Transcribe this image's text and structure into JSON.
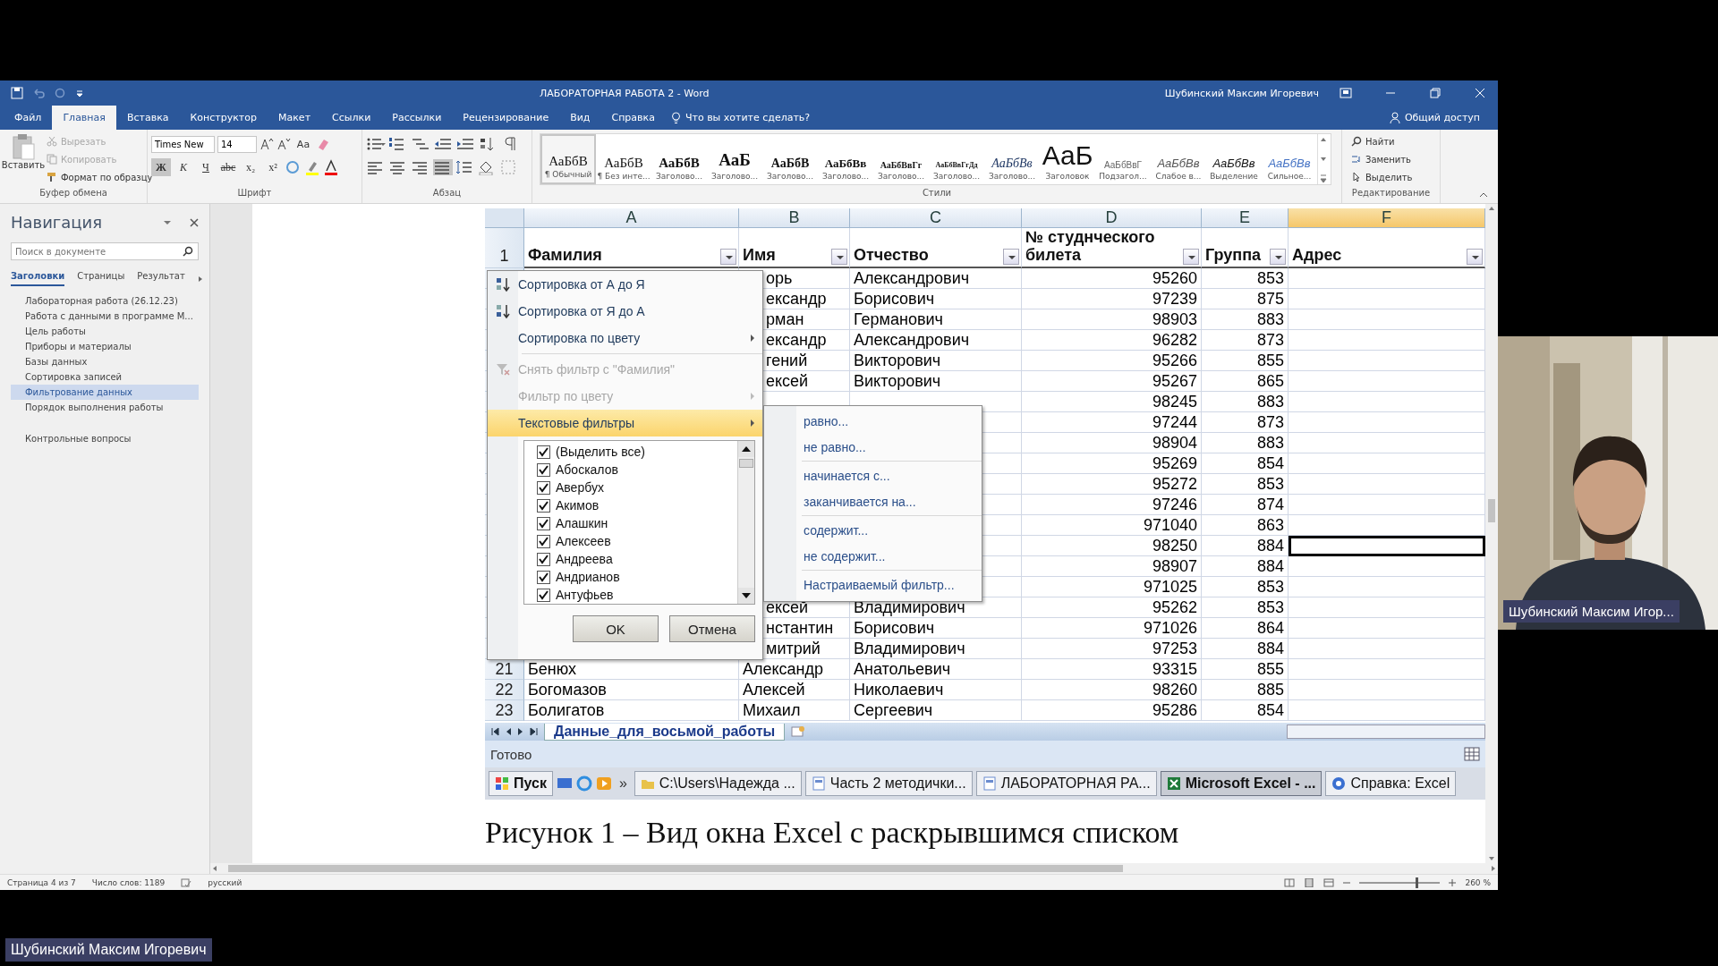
{
  "meeting": {
    "presenter_label": "Шубинский Максим Игоревич",
    "camera": {
      "kind": "picture",
      "name_label": "Шубинский Максим Игор..."
    }
  },
  "window": {
    "title": "ЛАБОРАТОРНАЯ РАБОТА 2  -  Word",
    "user": "Шубинский Максим Игоревич"
  },
  "tabs": [
    {
      "label": "Файл",
      "selected": false
    },
    {
      "label": "Главная",
      "selected": true
    },
    {
      "label": "Вставка",
      "selected": false
    },
    {
      "label": "Конструктор",
      "selected": false
    },
    {
      "label": "Макет",
      "selected": false
    },
    {
      "label": "Ссылки",
      "selected": false
    },
    {
      "label": "Рассылки",
      "selected": false
    },
    {
      "label": "Рецензирование",
      "selected": false
    },
    {
      "label": "Вид",
      "selected": false
    },
    {
      "label": "Справка",
      "selected": false
    }
  ],
  "tell_me": "Что вы хотите сделать?",
  "share": "Общий доступ",
  "ribbon": {
    "clipboard": {
      "label": "Буфер обмена",
      "paste": "Вставить",
      "items": [
        {
          "label": "Вырезать",
          "kind": "cut",
          "disabled": true
        },
        {
          "label": "Копировать",
          "kind": "copy",
          "disabled": true
        },
        {
          "label": "Формат по образцу",
          "kind": "painter",
          "disabled": false
        }
      ]
    },
    "font": {
      "label": "Шрифт",
      "family": "Times New",
      "size": "14",
      "case_button": "Aa",
      "format_buttons": [
        {
          "label": "Ж",
          "kind": "bold",
          "selected": true
        },
        {
          "label": "К",
          "kind": "italic",
          "selected": false
        },
        {
          "label": "Ч",
          "kind": "underline",
          "selected": false
        },
        {
          "label": "abc",
          "kind": "strike",
          "selected": false
        },
        {
          "label": "x₂",
          "kind": "sub",
          "selected": false
        },
        {
          "label": "x²",
          "kind": "sup",
          "selected": false
        }
      ]
    },
    "paragraph": {
      "label": "Абзац"
    },
    "styles": {
      "label": "Стили",
      "items": [
        {
          "preview": "АаБбВ",
          "name": "¶ Обычный",
          "kind": "normal",
          "selected": true
        },
        {
          "preview": "АаБбВ",
          "name": "¶ Без инте...",
          "kind": "normal",
          "selected": false
        },
        {
          "preview": "АаБбВ",
          "name": "Заголово...",
          "kind": "h1",
          "selected": false
        },
        {
          "preview": "АаБ",
          "name": "Заголово...",
          "kind": "h2",
          "selected": false
        },
        {
          "preview": "АаБбВ",
          "name": "Заголово...",
          "kind": "h3",
          "selected": false
        },
        {
          "preview": "АаБбВв",
          "name": "Заголово...",
          "kind": "h4",
          "selected": false
        },
        {
          "preview": "АаБбВвГг",
          "name": "Заголово...",
          "kind": "h5",
          "selected": false
        },
        {
          "preview": "АаБбВвГгДд",
          "name": "Заголово...",
          "kind": "h6",
          "selected": false
        },
        {
          "preview": "АаБбВв",
          "name": "Заголово...",
          "kind": "h7",
          "selected": false
        },
        {
          "preview": "АаБ",
          "name": "Заголовок",
          "kind": "title",
          "selected": false
        },
        {
          "preview": "АаБбВвГ",
          "name": "Подзагол...",
          "kind": "subtitle",
          "selected": false
        },
        {
          "preview": "АаБбВв",
          "name": "Слабое в...",
          "kind": "subtle",
          "selected": false
        },
        {
          "preview": "АаБбВв",
          "name": "Выделение",
          "kind": "emphasis",
          "selected": false
        },
        {
          "preview": "АаБбВв",
          "name": "Сильное...",
          "kind": "intense",
          "selected": false
        }
      ]
    },
    "editing": {
      "label": "Редактирование",
      "items": [
        {
          "label": "Найти",
          "kind": "find"
        },
        {
          "label": "Заменить",
          "kind": "replace"
        },
        {
          "label": "Выделить",
          "kind": "select"
        }
      ]
    }
  },
  "navigation": {
    "title": "Навигация",
    "search": {
      "placeholder": "Поиск в документе"
    },
    "tabs": [
      {
        "label": "Заголовки",
        "selected": true
      },
      {
        "label": "Страницы",
        "selected": false
      },
      {
        "label": "Результат",
        "selected": false
      }
    ],
    "groups": [
      [
        {
          "label": "Лабораторная работа (26.12.23)",
          "selected": false
        },
        {
          "label": "Работа с данными в программе М...",
          "selected": false
        },
        {
          "label": "Цель работы",
          "selected": false
        },
        {
          "label": "Приборы и материалы",
          "selected": false
        },
        {
          "label": "Базы данных",
          "selected": false
        },
        {
          "label": "Сортировка записей",
          "selected": false
        },
        {
          "label": "Фильтрование данных",
          "selected": true
        },
        {
          "label": "Порядок выполнения работы",
          "selected": false
        }
      ],
      [
        {
          "label": "Контрольные вопросы",
          "selected": false
        }
      ]
    ]
  },
  "excel": {
    "header_row_number": "1",
    "columns": [
      {
        "letter": "A",
        "header": "Фамилия",
        "selected": false
      },
      {
        "letter": "B",
        "header": "Имя",
        "selected": false
      },
      {
        "letter": "C",
        "header": "Отчество",
        "selected": false
      },
      {
        "letter": "D",
        "header": "№ студнческого билета",
        "selected": false
      },
      {
        "letter": "E",
        "header": "Группа",
        "selected": false
      },
      {
        "letter": "F",
        "header": "Адрес",
        "selected": true
      }
    ],
    "rows": [
      {
        "b": "орь",
        "c": "Александрович",
        "d": "95260",
        "e": "853",
        "selected": false
      },
      {
        "b": "ександр",
        "c": "Борисович",
        "d": "97239",
        "e": "875",
        "selected": false
      },
      {
        "b": "рман",
        "c": "Германович",
        "d": "98903",
        "e": "883",
        "selected": false
      },
      {
        "b": "ександр",
        "c": "Александрович",
        "d": "96282",
        "e": "873",
        "selected": false
      },
      {
        "b": "гений",
        "c": "Викторович",
        "d": "95266",
        "e": "855",
        "selected": false
      },
      {
        "b": "ексей",
        "c": "Викторович",
        "d": "95267",
        "e": "865",
        "selected": false
      },
      {
        "d": "98245",
        "e": "883",
        "selected": false
      },
      {
        "d": "97244",
        "e": "873",
        "selected": false
      },
      {
        "d": "98904",
        "e": "883",
        "selected": false
      },
      {
        "d": "95269",
        "e": "854",
        "selected": false
      },
      {
        "d": "95272",
        "e": "853",
        "selected": false
      },
      {
        "d": "97246",
        "e": "874",
        "selected": false
      },
      {
        "d": "971040",
        "e": "863",
        "selected": false
      },
      {
        "d": "98250",
        "e": "884",
        "selected": true
      },
      {
        "d": "98907",
        "e": "884",
        "selected": false
      },
      {
        "d": "971025",
        "e": "853",
        "selected": false
      },
      {
        "b": "ексей",
        "c": "Владимирович",
        "d": "95262",
        "e": "853",
        "selected": false
      },
      {
        "b": "нстантин",
        "c": "Борисович",
        "d": "971026",
        "e": "864",
        "selected": false
      },
      {
        "b": "митрий",
        "c": "Владимирович",
        "d": "97253",
        "e": "884",
        "selected": false
      },
      {
        "num": "21",
        "a": "Бенюх",
        "b": "Александр",
        "c": "Анатольевич",
        "d": "93315",
        "e": "855",
        "selected": false
      },
      {
        "num": "22",
        "a": "Богомазов",
        "b": "Алексей",
        "c": "Николаевич",
        "d": "98260",
        "e": "885",
        "selected": false
      },
      {
        "num": "23",
        "a": "Болигатов",
        "b": "Михаил",
        "c": "Сергеевич",
        "d": "95286",
        "e": "854",
        "selected": false
      }
    ],
    "filter_menu": {
      "groups": [
        [
          {
            "label": "Сортировка от А до Я",
            "kind": "sort_asc",
            "disabled": false,
            "has_submenu": false,
            "selected": false
          },
          {
            "label": "Сортировка от Я до А",
            "kind": "sort_desc",
            "disabled": false,
            "has_submenu": false,
            "selected": false
          },
          {
            "label": "Сортировка по цвету",
            "kind": "plain",
            "disabled": false,
            "has_submenu": true,
            "selected": false
          }
        ],
        [
          {
            "label": "Снять фильтр с \"Фамилия\"",
            "kind": "clear_filter",
            "disabled": true,
            "has_submenu": false,
            "selected": false
          },
          {
            "label": "Фильтр по цвету",
            "kind": "plain",
            "disabled": true,
            "has_submenu": true,
            "selected": false
          },
          {
            "label": "Текстовые фильтры",
            "kind": "plain",
            "disabled": false,
            "has_submenu": true,
            "selected": true
          }
        ]
      ],
      "values": [
        {
          "label": "(Выделить все)",
          "checked": true
        },
        {
          "label": "Абоскалов",
          "checked": true
        },
        {
          "label": "Авербух",
          "checked": true
        },
        {
          "label": "Акимов",
          "checked": true
        },
        {
          "label": "Алашкин",
          "checked": true
        },
        {
          "label": "Алексеев",
          "checked": true
        },
        {
          "label": "Андреева",
          "checked": true
        },
        {
          "label": "Андрианов",
          "checked": true
        },
        {
          "label": "Антуфьев",
          "checked": true
        }
      ],
      "ok": "OK",
      "cancel": "Отмена"
    },
    "text_filters": {
      "groups": [
        [
          "равно...",
          "не равно..."
        ],
        [
          "начинается с...",
          "заканчивается на..."
        ],
        [
          "содержит...",
          "не содержит..."
        ],
        [
          "Настраиваемый фильтр..."
        ]
      ]
    },
    "sheet_tab": "Данные_для_восьмой_работы",
    "status": "Готово",
    "taskbar": {
      "start": "Пуск",
      "more": "»",
      "items": [
        {
          "label": "C:\\Users\\Надежда ...",
          "kind": "folder",
          "selected": false
        },
        {
          "label": "Часть 2 методички...",
          "kind": "doc",
          "selected": false
        },
        {
          "label": "ЛАБОРАТОРНАЯ РА...",
          "kind": "doc",
          "selected": false
        },
        {
          "label": "Microsoft Excel - ...",
          "kind": "excel",
          "selected": true
        },
        {
          "label": "Справка: Excel",
          "kind": "help",
          "selected": false
        }
      ]
    }
  },
  "caption": "Рисунок 1 – Вид окна Excel с раскрывшимся списком",
  "status_bar": {
    "page": "Страница 4 из 7",
    "words": "Число слов: 1189",
    "language": "русский",
    "zoom": "260 %",
    "zoom_slider": {
      "level": 0.7
    }
  }
}
